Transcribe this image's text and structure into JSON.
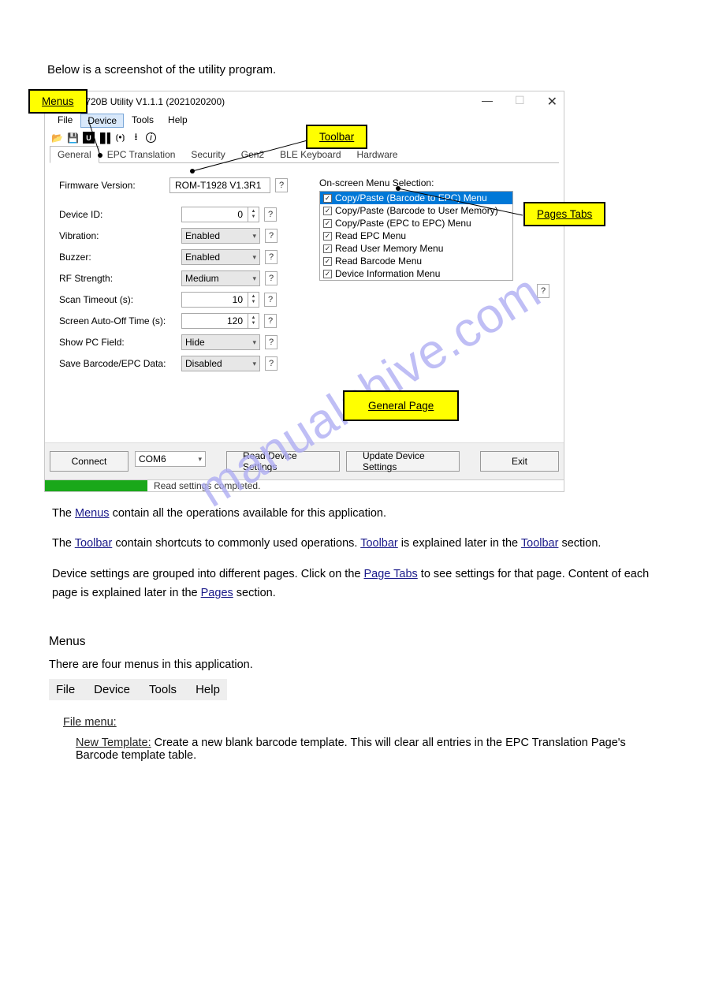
{
  "doc_title": "Below is a screenshot of the utility program.",
  "callouts": {
    "menus": "Menus",
    "toolbar": "Toolbar",
    "pages_tabs": "Pages Tabs",
    "general_page": "General Page"
  },
  "window": {
    "title": "AUR720B Utility V1.1.1 (2021020200)",
    "menubar": [
      "File",
      "Device",
      "Tools",
      "Help"
    ],
    "toolbar_icons": [
      "open-icon",
      "save-icon",
      "power-icon",
      "barcode-icon",
      "rf-icon",
      "download-icon",
      "info-icon"
    ],
    "tabs": [
      "General",
      "EPC Translation",
      "Security",
      "Gen2",
      "BLE Keyboard",
      "Hardware"
    ],
    "fields": {
      "firmware_label": "Firmware Version:",
      "firmware_value": "ROM-T1928 V1.3R1",
      "device_id_label": "Device ID:",
      "device_id_value": "0",
      "vibration_label": "Vibration:",
      "vibration_value": "Enabled",
      "buzzer_label": "Buzzer:",
      "buzzer_value": "Enabled",
      "rf_label": "RF Strength:",
      "rf_value": "Medium",
      "scan_to_label": "Scan Timeout (s):",
      "scan_to_value": "10",
      "screen_off_label": "Screen Auto-Off Time (s):",
      "screen_off_value": "120",
      "pc_field_label": "Show PC Field:",
      "pc_field_value": "Hide",
      "save_bc_label": "Save Barcode/EPC Data:",
      "save_bc_value": "Disabled"
    },
    "menu_sel_label": "On-screen Menu Selection:",
    "menu_sel_items": [
      "Copy/Paste (Barcode to EPC) Menu",
      "Copy/Paste (Barcode to User Memory)",
      "Copy/Paste (EPC to EPC) Menu",
      "Read EPC Menu",
      "Read User Memory Menu",
      "Read Barcode Menu",
      "Device Information Menu"
    ],
    "buttons": {
      "connect": "Connect",
      "com": "COM6",
      "read": "Read Device Settings",
      "update": "Update Device Settings",
      "exit": "Exit"
    },
    "status": "Read settings completed."
  },
  "body": {
    "p1a": "The ",
    "p1_menus": "Menus",
    "p1b": " contain all the operations available for this application.",
    "p2a": "The ",
    "p2_toolbar": "Toolbar",
    "p2b": " contain shortcuts to commonly used operations. ",
    "p2_toolbar2": "Toolbar",
    "p2c": " is explained later in the ",
    "p2_link": "Toolbar",
    "p2d": " section.",
    "p3a": "Device settings are grouped into different pages. Click on the ",
    "p3_link": "Page Tabs",
    "p3b": " to see settings for that page. Content of each page is explained later in the ",
    "p3_page": "Pages",
    "p3c": " section.",
    "sect_menus": "Menus",
    "sect_intro": "There are four menus in this application.",
    "menustrip": [
      "File",
      "Device",
      "Tools",
      "Help"
    ],
    "file_menu_h": "File menu:",
    "new_tpl_h": "New Template:",
    "new_tpl_body": " Create a new blank barcode template. This will clear all entries in the EPC Translation Page's Barcode template table."
  },
  "watermark": "manualshive.com"
}
